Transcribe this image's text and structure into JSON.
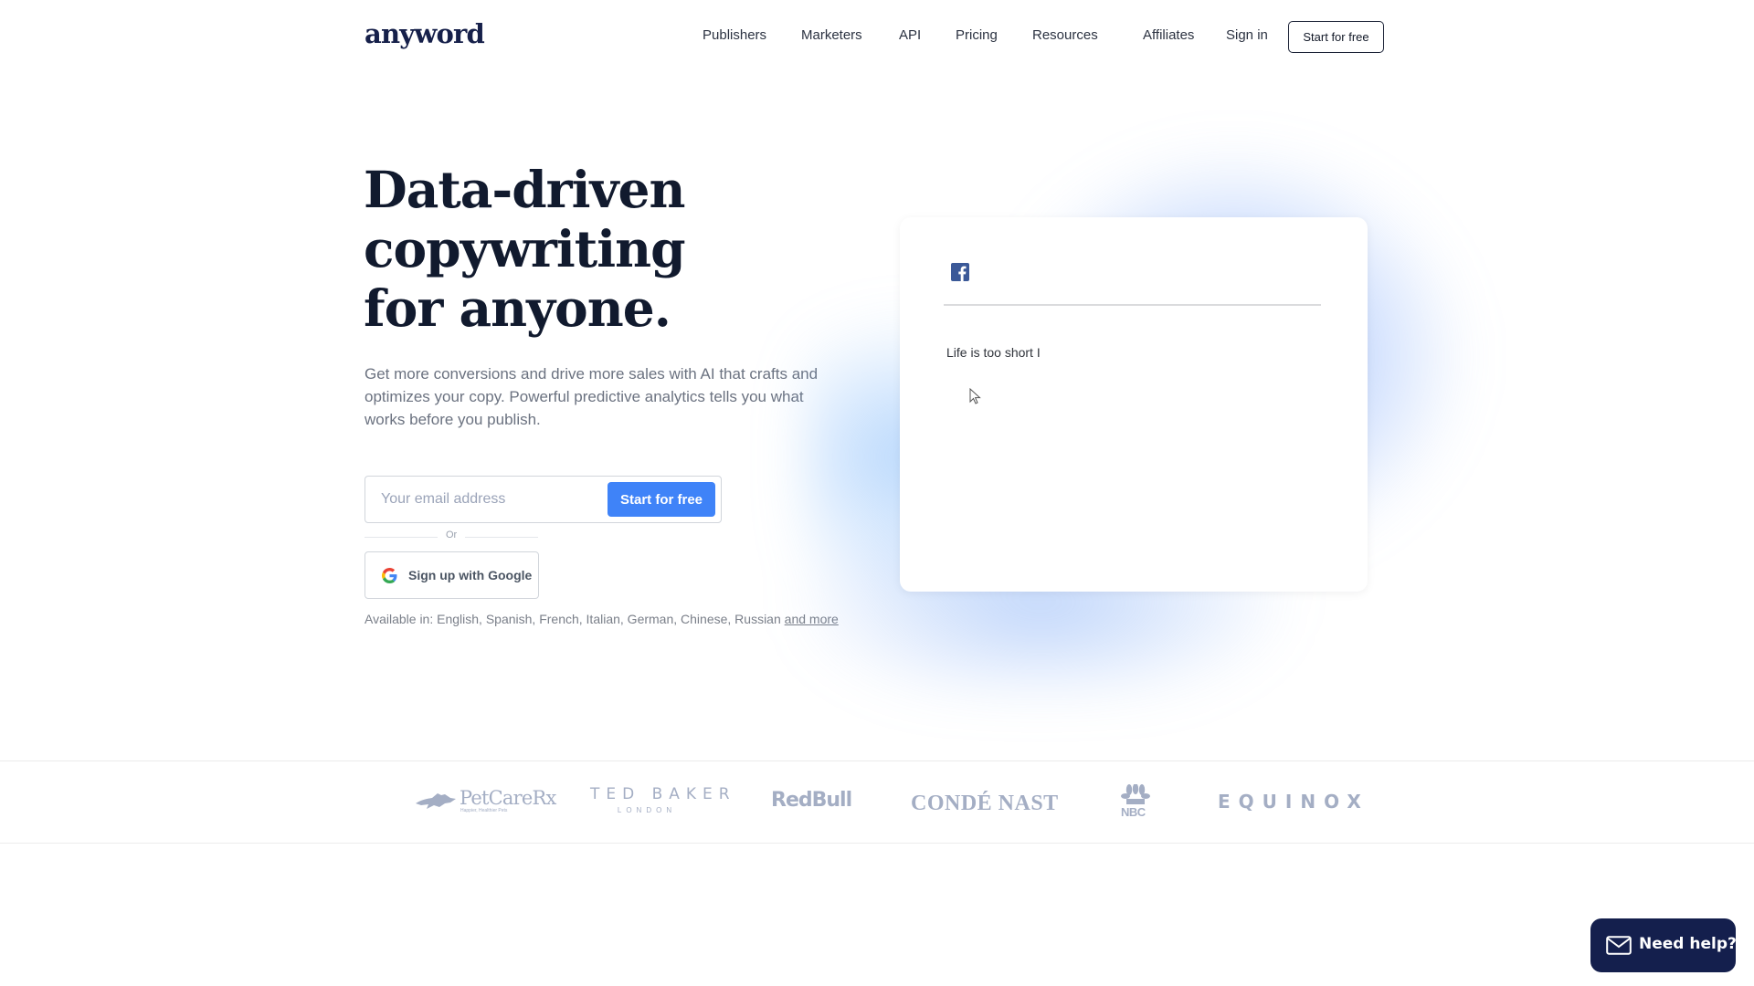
{
  "header": {
    "logo_text": "anyword",
    "nav": [
      {
        "label": "Publishers"
      },
      {
        "label": "Marketers"
      },
      {
        "label": "API"
      },
      {
        "label": "Pricing"
      },
      {
        "label": "Resources"
      },
      {
        "label": "Affiliates"
      },
      {
        "label": "Sign in"
      }
    ],
    "cta_label": "Start for free"
  },
  "hero": {
    "title_lines": [
      "Data-driven",
      "copywriting",
      "for anyone."
    ],
    "subtitle": "Get more conversions and drive more sales with AI that crafts and optimizes your copy. Powerful predictive analytics tells you what works before you publish.",
    "email_placeholder": "Your email address",
    "email_value": "",
    "submit_label": "Start for free",
    "or_text": "Or",
    "google_label": "Sign up with Google",
    "languages_prefix": "Available in: English, Spanish, French, Italian, German, Chinese, Russian ",
    "languages_link": "and more"
  },
  "preview_card": {
    "platform_icon": "facebook-icon",
    "typed_text": "Life is too short I"
  },
  "brands": [
    {
      "name": "PetCareRx",
      "tagline": "Happier, Healthier Pets"
    },
    {
      "name": "TED BAKER",
      "tagline": "LONDON"
    },
    {
      "name": "RedBull"
    },
    {
      "name": "CONDÉ NAST"
    },
    {
      "name": "NBC"
    },
    {
      "name": "EQUINOX"
    }
  ],
  "help_widget": {
    "label": "Need help?",
    "icon": "envelope-icon"
  },
  "colors": {
    "brand_navy": "#16204a",
    "accent_blue": "#3f83f8",
    "facebook_blue": "#3b5998",
    "help_bg": "#141f4d",
    "logo_gray": "#a4aec4"
  }
}
